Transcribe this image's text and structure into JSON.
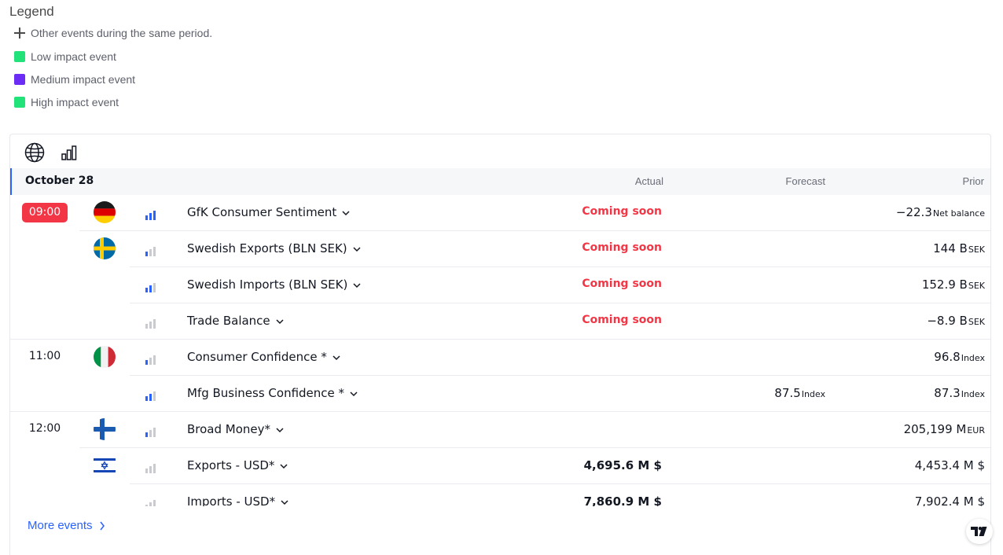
{
  "legend": {
    "title": "Legend",
    "items": [
      {
        "label": "Other events during the same period.",
        "icon": "plus-icon"
      },
      {
        "label": "Low impact event",
        "color": "#22e37a"
      },
      {
        "label": "Medium impact event",
        "color": "#6b2cf5"
      },
      {
        "label": "High impact event",
        "color": "#22e37a"
      }
    ]
  },
  "toolbar": {
    "icons": [
      "globe-icon",
      "bar-chart-icon"
    ]
  },
  "table": {
    "date": "October 28",
    "columns": {
      "actual": "Actual",
      "forecast": "Forecast",
      "prior": "Prior"
    },
    "rows": [
      {
        "time": "09:00",
        "time_highlight": true,
        "flag": "germany",
        "impact": 3,
        "name": "GfK Consumer Sentiment",
        "actual": "Coming soon",
        "forecast": "",
        "prior": "−22.3",
        "prior_unit": "Net balance"
      },
      {
        "time": "",
        "flag": "sweden",
        "impact": 1,
        "name": "Swedish Exports (BLN SEK)",
        "actual": "Coming soon",
        "forecast": "",
        "prior": "144 B",
        "prior_unit": "SEK"
      },
      {
        "time": "",
        "flag": "",
        "impact": 2,
        "name": "Swedish Imports (BLN SEK)",
        "actual": "Coming soon",
        "forecast": "",
        "prior": "152.9 B",
        "prior_unit": "SEK"
      },
      {
        "time": "",
        "flag": "",
        "impact": 0,
        "name": "Trade Balance",
        "actual": "Coming soon",
        "forecast": "",
        "prior": "−8.9 B",
        "prior_unit": "SEK"
      },
      {
        "time": "11:00",
        "flag": "italy",
        "impact": 1,
        "name": "Consumer Confidence *",
        "actual": "",
        "forecast": "",
        "prior": "96.8",
        "prior_unit": "Index"
      },
      {
        "time": "",
        "flag": "",
        "impact": 2,
        "name": "Mfg Business Confidence *",
        "actual": "",
        "forecast": "87.5",
        "forecast_unit": "Index",
        "prior": "87.3",
        "prior_unit": "Index"
      },
      {
        "time": "12:00",
        "flag": "finland",
        "impact": 1,
        "name": "Broad Money*",
        "actual": "",
        "forecast": "",
        "prior": "205,199 M",
        "prior_unit": "EUR"
      },
      {
        "time": "",
        "flag": "israel",
        "impact": 0,
        "name": "Exports - USD*",
        "actual": "4,695.6 M $",
        "forecast": "",
        "prior": "4,453.4 M $",
        "prior_unit": ""
      },
      {
        "time": "",
        "flag": "",
        "impact": 0,
        "name": "Imports - USD*",
        "actual": "7,860.9 M $",
        "forecast": "",
        "prior": "7,902.4 M $",
        "prior_unit": ""
      }
    ]
  },
  "more_events": "More events",
  "colors": {
    "accent": "#2962ff",
    "alert": "#f23645",
    "impact_on": "#2962ff",
    "impact_off": "#c9cbd1"
  }
}
